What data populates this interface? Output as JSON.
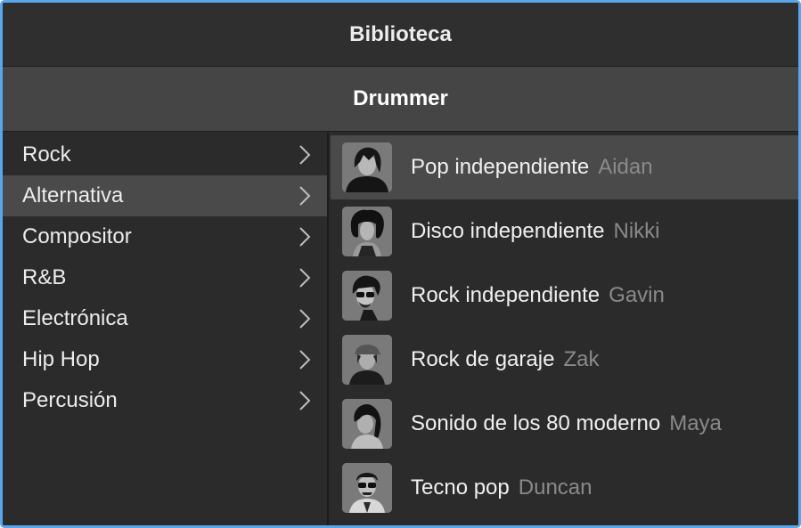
{
  "header": {
    "title": "Biblioteca",
    "category": "Drummer"
  },
  "genres": [
    {
      "label": "Rock",
      "selected": false
    },
    {
      "label": "Alternativa",
      "selected": true
    },
    {
      "label": "Compositor",
      "selected": false
    },
    {
      "label": "R&B",
      "selected": false
    },
    {
      "label": "Electrónica",
      "selected": false
    },
    {
      "label": "Hip Hop",
      "selected": false
    },
    {
      "label": "Percusión",
      "selected": false
    }
  ],
  "drummers": [
    {
      "genre": "Pop independiente",
      "name": "Aidan",
      "selected": true
    },
    {
      "genre": "Disco independiente",
      "name": "Nikki",
      "selected": false
    },
    {
      "genre": "Rock independiente",
      "name": "Gavin",
      "selected": false
    },
    {
      "genre": "Rock de garaje",
      "name": "Zak",
      "selected": false
    },
    {
      "genre": "Sonido de los 80 moderno",
      "name": "Maya",
      "selected": false
    },
    {
      "genre": "Tecno pop",
      "name": "Duncan",
      "selected": false
    }
  ],
  "icons": {
    "chevron": "chevron-right-icon",
    "avatar": "drummer-avatar-icon"
  },
  "colors": {
    "window_border": "#5aa6ea",
    "selection": "#4a4a4a",
    "background": "#2b2b2b"
  }
}
